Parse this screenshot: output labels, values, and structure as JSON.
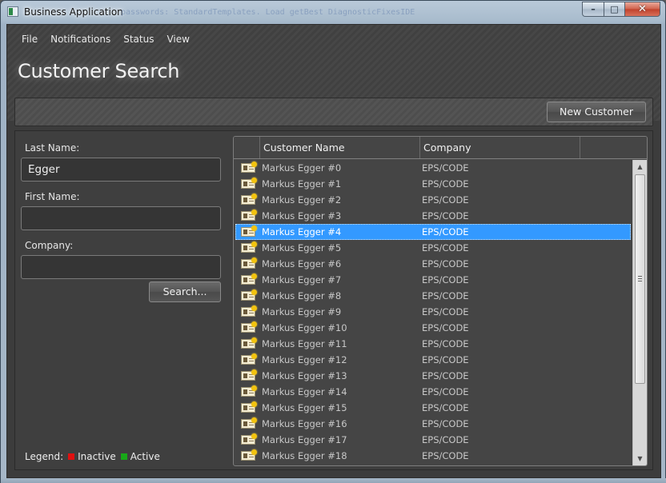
{
  "window": {
    "title": "Business Application",
    "title_ghost": "passwords: StandardTemplates. Load getBest DiagnosticFixesIDE",
    "controls": {
      "minimize": "–",
      "maximize": "□",
      "close": "✕"
    }
  },
  "menu": [
    {
      "label": "File"
    },
    {
      "label": "Notifications"
    },
    {
      "label": "Status"
    },
    {
      "label": "View"
    }
  ],
  "page": {
    "title": "Customer Search"
  },
  "toolbar": {
    "new_customer_label": "New Customer"
  },
  "search": {
    "last_name_label": "Last Name:",
    "last_name_value": "Egger",
    "first_name_label": "First Name:",
    "first_name_value": "",
    "company_label": "Company:",
    "company_value": "",
    "search_button_label": "Search..."
  },
  "legend": {
    "label": "Legend:",
    "inactive_label": "Inactive",
    "active_label": "Active",
    "inactive_color": "#e01010",
    "active_color": "#18a818"
  },
  "grid": {
    "columns": [
      {
        "label": ""
      },
      {
        "label": "Customer Name"
      },
      {
        "label": "Company"
      }
    ],
    "selected_index": 4,
    "row_icon": "business-card-icon",
    "selection_color": "#3399ff",
    "rows": [
      {
        "name": "Markus Egger #0",
        "company": "EPS/CODE"
      },
      {
        "name": "Markus Egger #1",
        "company": "EPS/CODE"
      },
      {
        "name": "Markus Egger #2",
        "company": "EPS/CODE"
      },
      {
        "name": "Markus Egger #3",
        "company": "EPS/CODE"
      },
      {
        "name": "Markus Egger #4",
        "company": "EPS/CODE"
      },
      {
        "name": "Markus Egger #5",
        "company": "EPS/CODE"
      },
      {
        "name": "Markus Egger #6",
        "company": "EPS/CODE"
      },
      {
        "name": "Markus Egger #7",
        "company": "EPS/CODE"
      },
      {
        "name": "Markus Egger #8",
        "company": "EPS/CODE"
      },
      {
        "name": "Markus Egger #9",
        "company": "EPS/CODE"
      },
      {
        "name": "Markus Egger #10",
        "company": "EPS/CODE"
      },
      {
        "name": "Markus Egger #11",
        "company": "EPS/CODE"
      },
      {
        "name": "Markus Egger #12",
        "company": "EPS/CODE"
      },
      {
        "name": "Markus Egger #13",
        "company": "EPS/CODE"
      },
      {
        "name": "Markus Egger #14",
        "company": "EPS/CODE"
      },
      {
        "name": "Markus Egger #15",
        "company": "EPS/CODE"
      },
      {
        "name": "Markus Egger #16",
        "company": "EPS/CODE"
      },
      {
        "name": "Markus Egger #17",
        "company": "EPS/CODE"
      },
      {
        "name": "Markus Egger #18",
        "company": "EPS/CODE"
      }
    ]
  },
  "scrollbar": {
    "up_arrow": "▲",
    "down_arrow": "▼"
  }
}
